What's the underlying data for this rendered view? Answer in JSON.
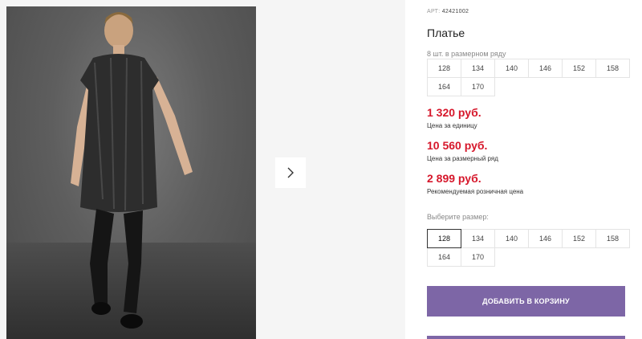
{
  "product": {
    "sku_label": "АРТ:",
    "sku": "42421002",
    "title": "Платье",
    "pack_note": "8 шт. в размерном ряду",
    "pack_sizes": [
      "128",
      "134",
      "140",
      "146",
      "152",
      "158",
      "164",
      "170"
    ]
  },
  "prices": {
    "unit": "1 320 руб.",
    "unit_label": "Цена за единицу",
    "pack": "10 560 руб.",
    "pack_label": "Цена за размерный ряд",
    "retail": "2 899 руб.",
    "retail_label": "Рекомендуемая розничная цена"
  },
  "size_select": {
    "label": "Выберите размер:",
    "options": [
      "128",
      "134",
      "140",
      "146",
      "152",
      "158",
      "164",
      "170"
    ],
    "selected": "128"
  },
  "actions": {
    "add_to_cart": "ДОБАВИТЬ В КОРЗИНУ"
  },
  "colors": {
    "accent": "#7d66a6",
    "price": "#d6172b"
  },
  "icons": {
    "next": "chevron-right-icon"
  }
}
